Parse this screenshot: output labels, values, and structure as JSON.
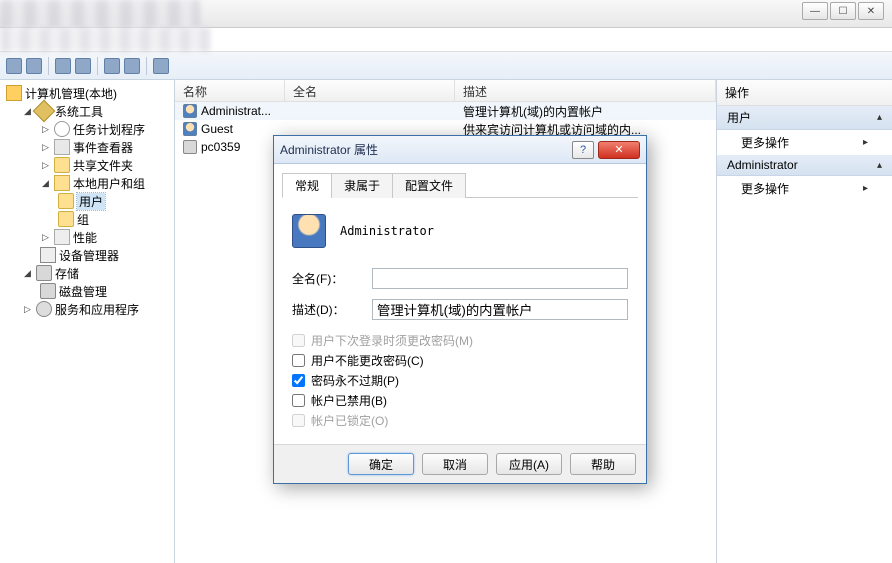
{
  "titlebar": {
    "min": "—",
    "max": "☐",
    "close": "✕"
  },
  "tree": {
    "root": "计算机管理(本地)",
    "sys_tools": "系统工具",
    "task_sched": "任务计划程序",
    "event_viewer": "事件查看器",
    "shared": "共享文件夹",
    "local_users": "本地用户和组",
    "users": "用户",
    "groups": "组",
    "perf": "性能",
    "dev_mgr": "设备管理器",
    "storage": "存储",
    "disk_mgmt": "磁盘管理",
    "services": "服务和应用程序"
  },
  "list": {
    "col_name": "名称",
    "col_full": "全名",
    "col_desc": "描述",
    "rows": [
      {
        "name": "Administrat...",
        "full": "",
        "desc": "管理计算机(域)的内置帐户"
      },
      {
        "name": "Guest",
        "full": "",
        "desc": "供来宾访问计算机或访问域的内..."
      },
      {
        "name": "pc0359",
        "full": "",
        "desc": ""
      }
    ]
  },
  "actions": {
    "header": "操作",
    "section1": "用户",
    "section2": "Administrator",
    "more": "更多操作"
  },
  "dialog": {
    "title": "Administrator 属性",
    "tabs": {
      "general": "常规",
      "member": "隶属于",
      "profile": "配置文件"
    },
    "username": "Administrator",
    "fullname_label": "全名(F)：",
    "desc_label": "描述(D)：",
    "fullname_value": "",
    "desc_value": "管理计算机(域)的内置帐户",
    "check_next_login": "用户下次登录时须更改密码(M)",
    "check_cannot_change": "用户不能更改密码(C)",
    "check_never_expire": "密码永不过期(P)",
    "check_disabled": "帐户已禁用(B)",
    "check_locked": "帐户已锁定(O)",
    "btn_ok": "确定",
    "btn_cancel": "取消",
    "btn_apply": "应用(A)",
    "btn_help": "帮助"
  }
}
